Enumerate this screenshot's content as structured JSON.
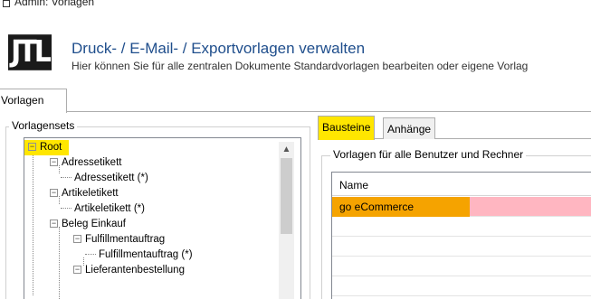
{
  "window": {
    "title": "Admin: Vorlagen"
  },
  "header": {
    "logo_text": "JTL",
    "title": "Druck- / E-Mail- / Exportvorlagen verwalten",
    "subtitle": "Hier können Sie für alle zentralen Dokumente Standardvorlagen bearbeiten oder eigene Vorlag"
  },
  "main_tabs": [
    {
      "label": "Vorlagen"
    }
  ],
  "left_group": {
    "label": "Vorlagensets"
  },
  "tree": [
    {
      "label": "Root",
      "level": 0,
      "expanded": true,
      "selected": true
    },
    {
      "label": "Adressetikett",
      "level": 1,
      "expanded": true
    },
    {
      "label": "Adressetikett (*)",
      "level": 2
    },
    {
      "label": "Artikeletikett",
      "level": 1,
      "expanded": true
    },
    {
      "label": "Artikeletikett (*)",
      "level": 2
    },
    {
      "label": "Beleg Einkauf",
      "level": 1,
      "expanded": true
    },
    {
      "label": "Fulfillmentauftrag",
      "level": 2,
      "expanded": true
    },
    {
      "label": "Fulfillmentauftrag (*)",
      "level": 3
    },
    {
      "label": "Lieferantenbestellung",
      "level": 2,
      "expanded": true
    }
  ],
  "sub_tabs": [
    {
      "label": "Bausteine",
      "active": true
    },
    {
      "label": "Anhänge",
      "active": false
    }
  ],
  "right_group": {
    "label": "Vorlagen für alle Benutzer und Rechner"
  },
  "grid": {
    "columns": [
      "Name"
    ],
    "rows": [
      {
        "name": "go eCommerce",
        "selected": true
      }
    ]
  },
  "colors": {
    "highlight": "#ffe600",
    "selected_cell": "#f5a300",
    "selected_row": "#ffb6c1",
    "title": "#1f4e8c"
  }
}
